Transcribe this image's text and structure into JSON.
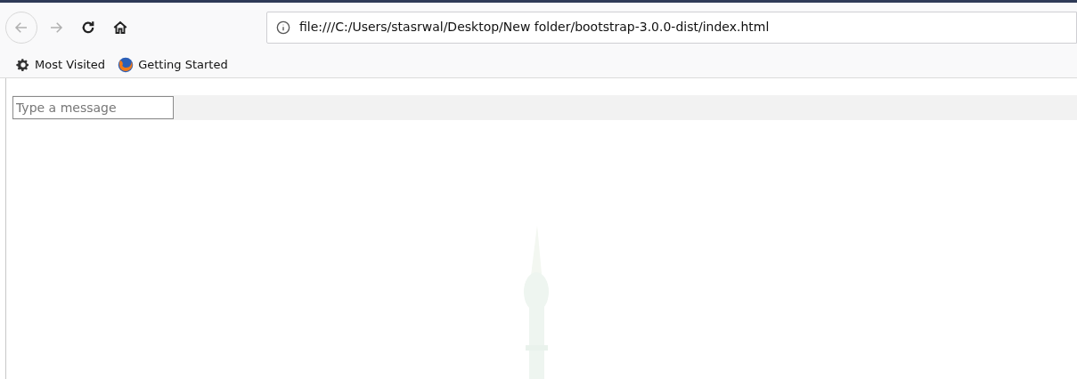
{
  "address_bar": {
    "url": "file:///C:/Users/stasrwal/Desktop/New folder/bootstrap-3.0.0-dist/index.html"
  },
  "bookmarks": [
    {
      "label": "Most Visited",
      "kind": "gear"
    },
    {
      "label": "Getting Started",
      "kind": "globe"
    }
  ],
  "page": {
    "message_field": {
      "placeholder": "Type a message"
    }
  }
}
